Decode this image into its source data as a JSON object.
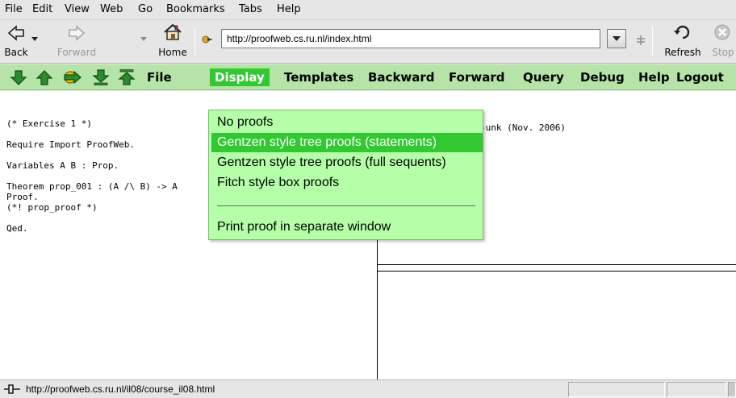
{
  "menubar": {
    "items": [
      "File",
      "Edit",
      "View",
      "Web",
      "Go",
      "Bookmarks",
      "Tabs",
      "Help"
    ]
  },
  "nav": {
    "back_label": "Back",
    "forward_label": "Forward",
    "home_label": "Home",
    "url": "http://proofweb.cs.ru.nl/index.html",
    "refresh_label": "Refresh",
    "stop_label": "Stop"
  },
  "proofweb_toolbar": {
    "menus": [
      "File",
      "Display",
      "Templates",
      "Backward",
      "Forward",
      "Query",
      "Debug",
      "Help",
      "Logout"
    ],
    "active_menu": "Display"
  },
  "display_menu": {
    "items": [
      "No proofs",
      "Gentzen style tree proofs (statements)",
      "Gentzen style tree proofs (full sequents)",
      "Fitch style box proofs",
      "Print proof in separate window"
    ],
    "highlighted": "Gentzen style tree proofs (statements)"
  },
  "editor": {
    "lines": [
      "(* Exercise 1 *)",
      "",
      "Require Import ProofWeb.",
      "",
      "Variables A B : Prop.",
      "",
      "Theorem prop_001 : (A /\\ B) -> A",
      "Proof.",
      "(*! prop_proof *)",
      "",
      "Qed."
    ]
  },
  "goals": {
    "fragment": "-unk (Nov. 2006)"
  },
  "statusbar": {
    "text": "http://proofweb.cs.ru.nl/il08/course_il08.html"
  }
}
